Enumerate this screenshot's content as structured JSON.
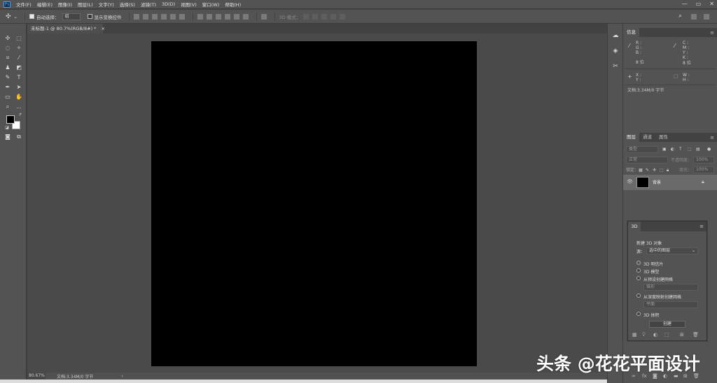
{
  "app": {
    "logo": "Ps"
  },
  "menu": [
    "文件(F)",
    "编辑(E)",
    "图像(I)",
    "图层(L)",
    "文字(Y)",
    "选择(S)",
    "滤镜(T)",
    "3D(D)",
    "视图(V)",
    "窗口(W)",
    "帮助(H)"
  ],
  "window_controls": {
    "minimize": "—",
    "maximize": "▭",
    "close": "✕"
  },
  "options_bar": {
    "auto_select_label": "自动选择：",
    "auto_select_value": "组",
    "show_transform_label": "显示变换控件",
    "mode_3d_label": "3D 模式："
  },
  "document": {
    "tab_title": "未标题-1 @ 80.7%(RGB/8#) *",
    "zoom": "80.67%",
    "status": "文档:3.34M/0 字节",
    "canvas_color": "#000000"
  },
  "info_panel": {
    "tab": "信息",
    "rgb_labels": [
      "R :",
      "G :",
      "B :"
    ],
    "cmyk_labels": [
      "C :",
      "M :",
      "Y :",
      "K :"
    ],
    "bit_left": "8 位",
    "bit_right": "8 位",
    "xy_labels": [
      "X :",
      "Y :"
    ],
    "wh_labels": [
      "W :",
      "H :"
    ],
    "doc_status": "文档:3.34M/0 字节"
  },
  "layers_panel": {
    "tabs": [
      "图层",
      "通道",
      "属性"
    ],
    "filter_placeholder": "类型",
    "blend_mode": "正常",
    "opacity_label": "不透明度：",
    "opacity_value": "100%",
    "lock_label": "锁定：",
    "fill_label": "填充：",
    "fill_value": "100%",
    "layer_name": "背景"
  },
  "panel_3d": {
    "tab": "3D",
    "section_title": "新建 3D 对象",
    "source_label": "源：",
    "source_value": "选中的图层",
    "options": [
      "3D 明信片",
      "3D 模型",
      "从预设创建网格",
      "从深度映射创建网格",
      "3D 体积"
    ],
    "preset_value": "锥形",
    "depth_value": "平面",
    "create_label": "创建"
  },
  "watermark": "头条 @花花平面设计"
}
